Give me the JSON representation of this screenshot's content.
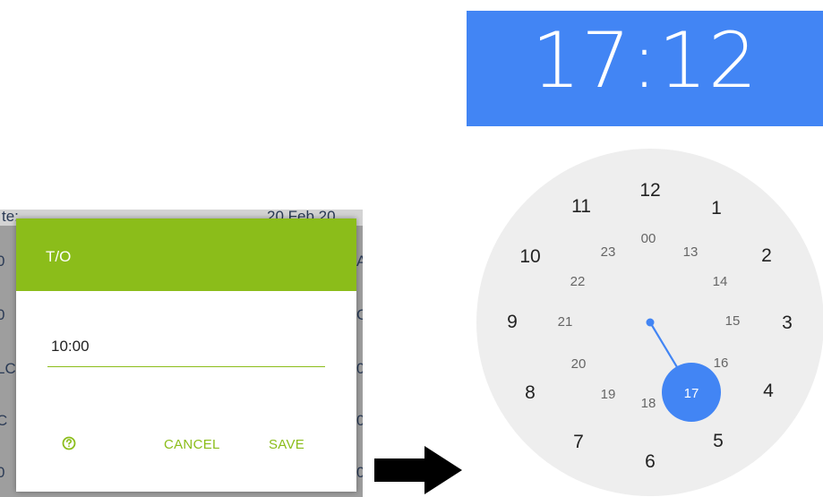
{
  "background_app": {
    "top_left_text": "te:",
    "top_right_text": "20 Feb 20",
    "left_edge_chars": [
      "0",
      "0",
      "LC",
      "C",
      "0"
    ],
    "right_edge_chars": [
      "A",
      "C",
      "0",
      "0",
      "0"
    ]
  },
  "dialog": {
    "title": "T/O",
    "time_value": "10:00",
    "help_icon": "help-circle-icon",
    "cancel_label": "CANCEL",
    "save_label": "SAVE"
  },
  "arrow_icon": "right-arrow-icon",
  "time_picker": {
    "display_time": "17:12",
    "selected_hour": "17",
    "outer_hours": [
      "12",
      "1",
      "2",
      "3",
      "4",
      "5",
      "6",
      "7",
      "8",
      "9",
      "10",
      "11"
    ],
    "inner_hours": [
      "00",
      "13",
      "14",
      "15",
      "16",
      "17",
      "18",
      "19",
      "20",
      "21",
      "22",
      "23"
    ]
  },
  "colors": {
    "dialog_accent": "#8bbd1a",
    "picker_accent": "#4285f4",
    "clock_face": "#eeeeee"
  }
}
